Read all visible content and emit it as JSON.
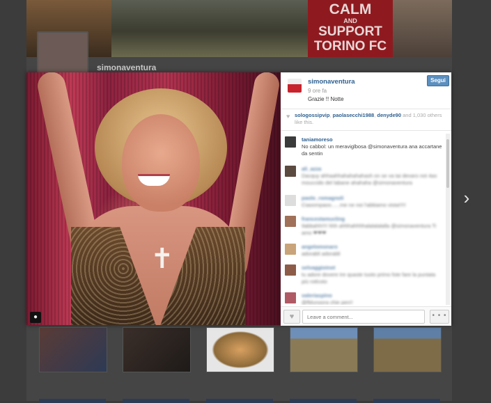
{
  "background": {
    "banner_text": [
      "CALM",
      "AND",
      "SUPPORT",
      "TORINO FC"
    ],
    "profile_username": "simonaventura"
  },
  "post": {
    "username": "simonaventura",
    "time": "9 ore fa",
    "caption": "Grazie !! Notte",
    "follow_label": "Segui",
    "likes": {
      "users": [
        "sologossipvip",
        "paolasecchi1988",
        "denyde90"
      ],
      "and_label": "and",
      "count": "1,030",
      "suffix": "others like this."
    },
    "comments": [
      {
        "user": "taniamoreso",
        "text": "No cabbol: un meraviglbosa @simonaventura ana accartane da sentin"
      },
      {
        "user": "ali_azza",
        "text": "Dacquy ahhaahhahahahahash on se va tai devaro not 4ax mouccido del labane ahahaha @simonaventura"
      },
      {
        "user": "paolo_romagnoli",
        "text": "Ciaoompaoo......me ne noi l'abbiamo vista!!!!!"
      },
      {
        "user": "francestamucling",
        "text": "Ilabbahh!!!! hhh ahhhahhhhalalalalalla @simonaventura Ti amo ❤❤❤"
      },
      {
        "user": "angelomonaro",
        "text": "adorabli adorabli"
      },
      {
        "user": "selvaggioinot",
        "text": "tu adore dovere tre quaste tuoto primo fote fare la puntata più rotlcoto"
      },
      {
        "user": "valeriaspino",
        "text": "@fblunoora chie pen!!"
      }
    ],
    "comment_placeholder": "Leave a comment...",
    "more_label": "• • •"
  },
  "icons": {
    "next": "chevron-right-icon",
    "like": "heart-icon",
    "user_tag": "user-tag-icon"
  },
  "colors": {
    "link": "#2d5f8f",
    "follow": "#5b8fbf",
    "banner_red": "#8e1a1f"
  }
}
